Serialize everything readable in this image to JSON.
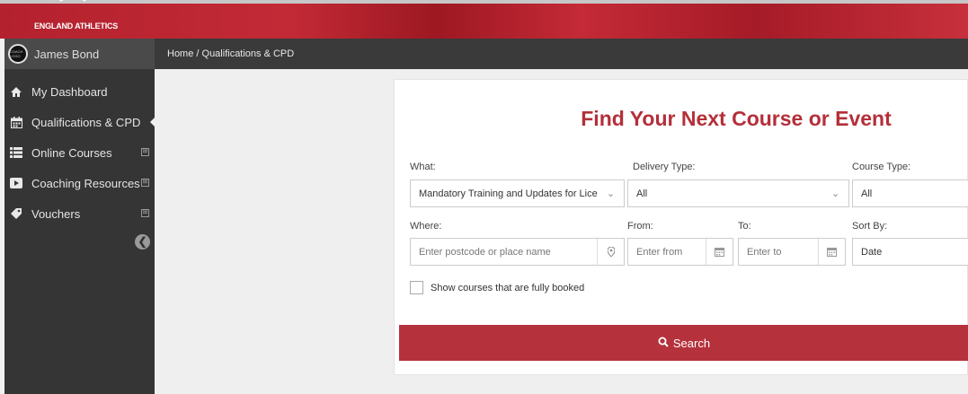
{
  "banner": {
    "brand": "ENGLAND ATHLETICS"
  },
  "user": {
    "name": "James Bond",
    "avatar_text": "COACH LOGO"
  },
  "sidebar": {
    "items": [
      {
        "label": "My Dashboard",
        "icon": "home-icon",
        "expandable": false,
        "active": false
      },
      {
        "label": "Qualifications & CPD",
        "icon": "calendar-icon",
        "expandable": false,
        "active": true
      },
      {
        "label": "Online Courses",
        "icon": "list-icon",
        "expandable": true,
        "active": false
      },
      {
        "label": "Coaching Resources",
        "icon": "play-icon",
        "expandable": true,
        "active": false
      },
      {
        "label": "Vouchers",
        "icon": "tag-icon",
        "expandable": true,
        "active": false
      }
    ],
    "expand_symbol": "⊞",
    "collapse_symbol": "❮"
  },
  "breadcrumb": {
    "text": "Home /  Qualifications & CPD"
  },
  "form": {
    "title": "Find Your Next Course or Event",
    "what": {
      "label": "What:",
      "value": "Mandatory Training and Updates for Licence"
    },
    "delivery_type": {
      "label": "Delivery Type:",
      "value": "All"
    },
    "course_type": {
      "label": "Course Type:",
      "value": "All"
    },
    "where": {
      "label": "Where:",
      "placeholder": "Enter postcode or place name"
    },
    "from": {
      "label": "From:",
      "placeholder": "Enter from"
    },
    "to": {
      "label": "To:",
      "placeholder": "Enter to"
    },
    "sort_by": {
      "label": "Sort By:",
      "value": "Date"
    },
    "fully_booked": {
      "label": "Show courses that are fully booked",
      "checked": false
    },
    "search_label": "Search"
  },
  "colors": {
    "brand_red": "#b5323c",
    "sidebar_bg": "#353535",
    "title_red": "#b42f3a"
  }
}
